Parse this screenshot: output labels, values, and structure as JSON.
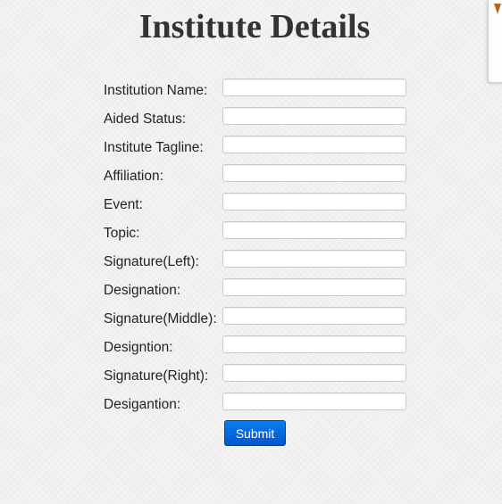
{
  "page": {
    "title": "Institute Details"
  },
  "form": {
    "fields": [
      {
        "label": "Institution Name:",
        "value": ""
      },
      {
        "label": "Aided Status:",
        "value": ""
      },
      {
        "label": "Institute Tagline:",
        "value": ""
      },
      {
        "label": "Affiliation:",
        "value": ""
      },
      {
        "label": "Event:",
        "value": ""
      },
      {
        "label": "Topic:",
        "value": ""
      },
      {
        "label": "Signature(Left):",
        "value": ""
      },
      {
        "label": "Designation:",
        "value": ""
      },
      {
        "label": "Signature(Middle):",
        "value": ""
      },
      {
        "label": "Designtion:",
        "value": ""
      },
      {
        "label": "Signature(Right):",
        "value": ""
      },
      {
        "label": "Desigantion:",
        "value": ""
      }
    ],
    "submit_label": "Submit"
  },
  "colors": {
    "submit_button": "#0a6ee0",
    "page_background": "#f3f3f3"
  }
}
